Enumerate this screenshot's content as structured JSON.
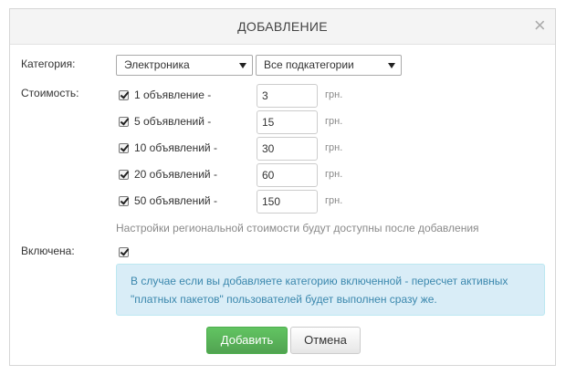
{
  "modal": {
    "title": "ДОБАВЛЕНИЕ",
    "close_icon": "×"
  },
  "form": {
    "category_label": "Категория:",
    "category_value": "Электроника",
    "subcategory_value": "Все подкатегории",
    "cost_label": "Стоимость:",
    "price_rows": [
      {
        "label": "1 объявление -",
        "value": "3",
        "unit": "грн.",
        "checked": true
      },
      {
        "label": "5 объявлений -",
        "value": "15",
        "unit": "грн.",
        "checked": true
      },
      {
        "label": "10 объявлений -",
        "value": "30",
        "unit": "грн.",
        "checked": true
      },
      {
        "label": "20 объявлений -",
        "value": "60",
        "unit": "грн.",
        "checked": true
      },
      {
        "label": "50 объявлений -",
        "value": "150",
        "unit": "грн.",
        "checked": true
      }
    ],
    "hint": "Настройки региональной стоимости будут доступны после добавления",
    "enabled_label": "Включена:",
    "enabled_checked": true,
    "info_line1": "В случае если вы добавляете категорию включенной - пересчет активных",
    "info_line2": "\"платных пакетов\" пользователей будет выполнен сразу же."
  },
  "buttons": {
    "add": "Добавить",
    "cancel": "Отмена"
  },
  "colors": {
    "accent_green": "#5cb85c",
    "info_bg": "#d9edf7",
    "info_text": "#3a87ad"
  }
}
